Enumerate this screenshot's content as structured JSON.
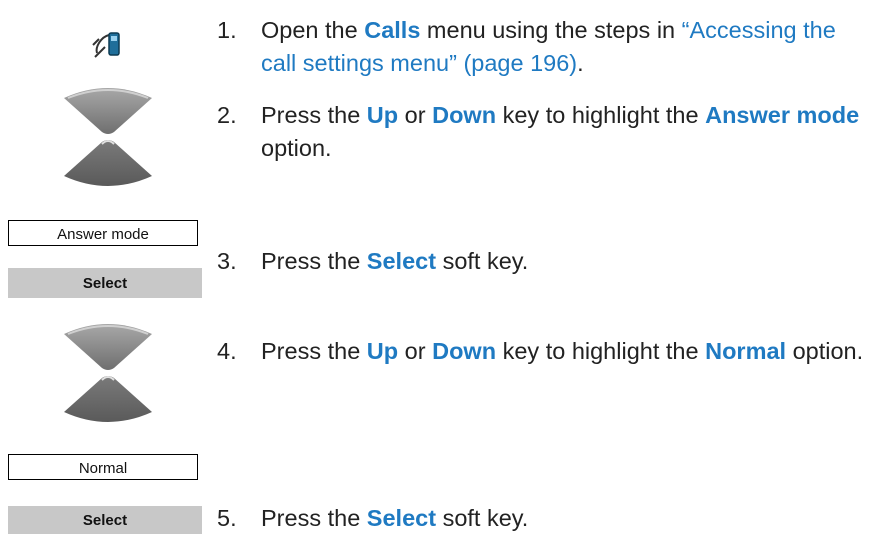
{
  "icons": {
    "calls_menu_icon": "phone-handset-gear-icon",
    "nav_key_up": "nav-key-up-icon",
    "nav_key_down": "nav-key-down-icon"
  },
  "colors": {
    "keyword": "#1f7ac2",
    "softkey_bg": "#c8c8c8",
    "navkey_fill": "#8a8a8a"
  },
  "screens": {
    "answer_mode": "Answer mode",
    "normal": "Normal"
  },
  "softkeys": {
    "select_1": "Select",
    "select_2": "Select"
  },
  "steps": [
    {
      "num": "1.",
      "pre": "Open the ",
      "kw1": "Calls",
      "mid": " menu using the steps in ",
      "link": "“Accessing the call settings menu” (page 196)",
      "post": "."
    },
    {
      "num": "2.",
      "pre": "Press the ",
      "kw1": "Up",
      "or": " or ",
      "kw2": "Down",
      "mid": " key to highlight the ",
      "kw3": "Answer mode",
      "post": " option."
    },
    {
      "num": "3.",
      "pre": "Press the ",
      "kw1": "Select",
      "post": " soft key."
    },
    {
      "num": "4.",
      "pre": "Press the ",
      "kw1": "Up",
      "or": " or ",
      "kw2": "Down",
      "mid": " key to highlight the ",
      "kw3": "Normal",
      "post": " option."
    },
    {
      "num": "5.",
      "pre": "Press the ",
      "kw1": "Select",
      "post": " soft key."
    }
  ]
}
